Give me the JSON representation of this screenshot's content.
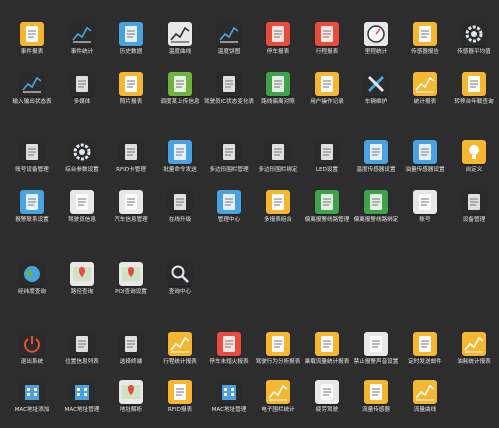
{
  "colors": {
    "background": "#2d2d2d",
    "label": "#e6e6e6"
  },
  "rows": [
    {
      "items": [
        {
          "label": "事件报表",
          "icon": "clipboard-report-icon",
          "color": "#f5b731"
        },
        {
          "label": "事件统计",
          "icon": "line-chart-icon",
          "color": "#2b2b2b"
        },
        {
          "label": "历史数据",
          "icon": "film-data-icon",
          "color": "#4aa3df"
        },
        {
          "label": "温度曲线",
          "icon": "temperature-curve-icon",
          "color": "#e8e8e8"
        },
        {
          "label": "温度饼图",
          "icon": "pie-chart-icon",
          "color": "#2b2b2b"
        },
        {
          "label": "停车报表",
          "icon": "parking-report-icon",
          "color": "#e74c3c"
        },
        {
          "label": "行程报表",
          "icon": "route-report-icon",
          "color": "#e74c3c"
        },
        {
          "label": "里程统计",
          "icon": "speedometer-icon",
          "color": "#e8e8e8"
        },
        {
          "label": "传感器报告",
          "icon": "sensor-report-icon",
          "color": "#f5b731"
        },
        {
          "label": "传感器平均值",
          "icon": "sliders-icon",
          "color": "#2b2b2b"
        }
      ]
    },
    {
      "items": [
        {
          "label": "输入输出状态表",
          "icon": "io-status-icon",
          "color": "#2b2b2b"
        },
        {
          "label": "多媒体",
          "icon": "multimedia-icon",
          "color": "#2b2b2b"
        },
        {
          "label": "照片报表",
          "icon": "photo-report-icon",
          "color": "#f5b731"
        },
        {
          "label": "调度某上传信息",
          "icon": "dispatch-image-icon",
          "color": "#6db33f"
        },
        {
          "label": "驾驶员IC状态变化表",
          "icon": "driver-ic-icon",
          "color": "#2b2b2b"
        },
        {
          "label": "路线偏离对照",
          "icon": "route-deviation-icon",
          "color": "#3fa34d"
        },
        {
          "label": "用户操作记录",
          "icon": "user-log-icon",
          "color": "#f5b731"
        },
        {
          "label": "车辆维护",
          "icon": "wrench-icon",
          "color": "#2b2b2b"
        },
        {
          "label": "统计报表",
          "icon": "statistics-report-icon",
          "color": "#f5b731"
        },
        {
          "label": "转移台年载查询",
          "icon": "transfer-query-icon",
          "color": "#f5b731"
        }
      ]
    },
    {
      "items": [
        {
          "label": "账号设备管理",
          "icon": "account-device-icon",
          "color": "#2b2b2b"
        },
        {
          "label": "综合参数设置",
          "icon": "gear-icon",
          "color": "#2b2b2b"
        },
        {
          "label": "RFID卡管理",
          "icon": "rfid-card-icon",
          "color": "#2b2b2b"
        },
        {
          "label": "批量命令发送",
          "icon": "batch-command-icon",
          "color": "#4aa3df"
        },
        {
          "label": "多边形围栏管理",
          "icon": "polygon-fence-icon",
          "color": "#2b2b2b"
        },
        {
          "label": "多边形围栏绑定",
          "icon": "fence-bind-icon",
          "color": "#2b2b2b"
        },
        {
          "label": "LED设置",
          "icon": "led-display-icon",
          "color": "#2b2b2b"
        },
        {
          "label": "温度传感器设置",
          "icon": "temperature-sensor-icon",
          "color": "#4aa3df"
        },
        {
          "label": "油量传感器设置",
          "icon": "fuel-sensor-icon",
          "color": "#4aa3df"
        },
        {
          "label": "自定义",
          "icon": "lightbulb-icon",
          "color": "#f5b731"
        }
      ]
    },
    {
      "items": [
        {
          "label": "报警联系设置",
          "icon": "alarm-contact-icon",
          "color": "#4aa3df"
        },
        {
          "label": "驾驶员信息",
          "icon": "driver-info-icon",
          "color": "#e8e8e8"
        },
        {
          "label": "汽车信息管理",
          "icon": "car-info-icon",
          "color": "#e8e8e8"
        },
        {
          "label": "在线升级",
          "icon": "online-upgrade-icon",
          "color": "#2b2b2b"
        },
        {
          "label": "管理中心",
          "icon": "management-center-icon",
          "color": "#4aa3df"
        },
        {
          "label": "多报表组合",
          "icon": "multi-report-icon",
          "color": "#f5b731"
        },
        {
          "label": "偏离报警线路管理",
          "icon": "deviation-route-icon",
          "color": "#3fa34d"
        },
        {
          "label": "偏离报警线路绑定",
          "icon": "deviation-bind-icon",
          "color": "#3fa34d"
        },
        {
          "label": "账号",
          "icon": "account-card-icon",
          "color": "#e8e8e8"
        },
        {
          "label": "设备管理",
          "icon": "device-management-icon",
          "color": "#2b2b2b"
        }
      ]
    },
    {
      "items": [
        {
          "label": "经纬度查询",
          "icon": "globe-icon",
          "color": "#2b2b2b"
        },
        {
          "label": "路径查询",
          "icon": "route-query-icon",
          "color": "#e8e8e8"
        },
        {
          "label": "POI查询设置",
          "icon": "poi-icon",
          "color": "#e8e8e8"
        },
        {
          "label": "查询中心",
          "icon": "magnifier-icon",
          "color": "#2b2b2b"
        }
      ]
    },
    {
      "items": [
        {
          "label": "退出系统",
          "icon": "power-icon",
          "color": "#2b2b2b"
        },
        {
          "label": "位置信息列表",
          "icon": "location-list-icon",
          "color": "#2b2b2b"
        },
        {
          "label": "选择终端",
          "icon": "terminal-car-icon",
          "color": "#2b2b2b"
        },
        {
          "label": "行程统计报表",
          "icon": "trip-stat-icon",
          "color": "#f5b731"
        },
        {
          "label": "停车未熄火报表",
          "icon": "idle-parking-icon",
          "color": "#e74c3c"
        },
        {
          "label": "驾驶行为分析报表",
          "icon": "driving-behavior-icon",
          "color": "#f5b731"
        },
        {
          "label": "乘载流量统计报表",
          "icon": "passenger-flow-icon",
          "color": "#f5b731"
        },
        {
          "label": "禁止报警声音设置",
          "icon": "mute-alarm-icon",
          "color": "#e8e8e8"
        },
        {
          "label": "定时发送邮件",
          "icon": "scheduled-mail-icon",
          "color": "#f5b731"
        },
        {
          "label": "油耗统计报表",
          "icon": "fuel-stat-icon",
          "color": "#f5b731"
        }
      ]
    },
    {
      "items": [
        {
          "label": "MAC地址添加",
          "icon": "mac-add-icon",
          "color": "#2b2b2b"
        },
        {
          "label": "MAC地址管理",
          "icon": "mac-manage-icon",
          "color": "#2b2b2b"
        },
        {
          "label": "地址解析",
          "icon": "address-resolve-icon",
          "color": "#e8e8e8"
        },
        {
          "label": "RFID报表",
          "icon": "rfid-report-icon",
          "color": "#f5b731"
        },
        {
          "label": "MAC地址管理",
          "icon": "mac-manage-2-icon",
          "color": "#2b2b2b"
        },
        {
          "label": "电子围栏统计",
          "icon": "fence-stat-icon",
          "color": "#f5b731"
        },
        {
          "label": "疲劳驾驶",
          "icon": "fatigue-driving-icon",
          "color": "#e8e8e8"
        },
        {
          "label": "流量传感器",
          "icon": "flow-sensor-icon",
          "color": "#f5b731"
        },
        {
          "label": "流量曲线",
          "icon": "flow-curve-icon",
          "color": "#f5b731"
        }
      ]
    }
  ]
}
